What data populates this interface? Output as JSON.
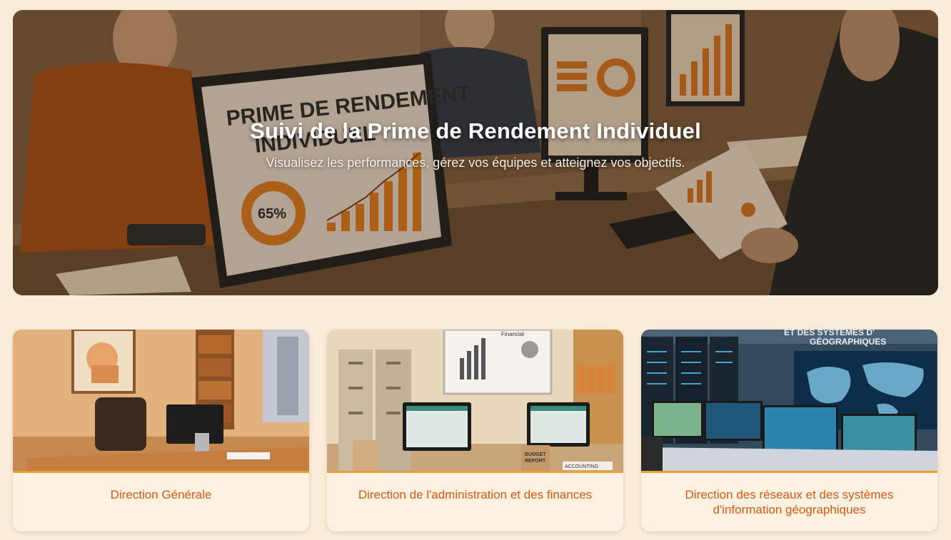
{
  "hero": {
    "title": "Suivi de la Prime de Rendement Individuel",
    "subtitle": "Visualisez les performances, gérez vos équipes et atteignez vos objectifs.",
    "screen_heading_line1": "PRIME DE RENDEMENT",
    "screen_heading_line2": "INDIVIDUEL",
    "screen_percentage": "65%"
  },
  "cards": [
    {
      "label": "Direction Générale",
      "image": "executive-office-image"
    },
    {
      "label": "Direction de l'administration et des finances",
      "image": "finance-office-image",
      "board_label": "Financial",
      "box_label_line1": "BUDGET",
      "box_label_line2": "REPORT",
      "binder_label": "ACCOUNTING"
    },
    {
      "label": "Direction des réseaux et des systèmes d'information géographiques",
      "image": "gis-control-room-image",
      "wall_sign_line1": "ET DES SYSTÈMES D'",
      "wall_sign_line2": "GÉOGRAPHIQUES"
    }
  ],
  "colors": {
    "background": "#f9ecd9",
    "accent": "#d9580f",
    "divider": "#e8a136",
    "card_bg": "#fdf2e2"
  }
}
